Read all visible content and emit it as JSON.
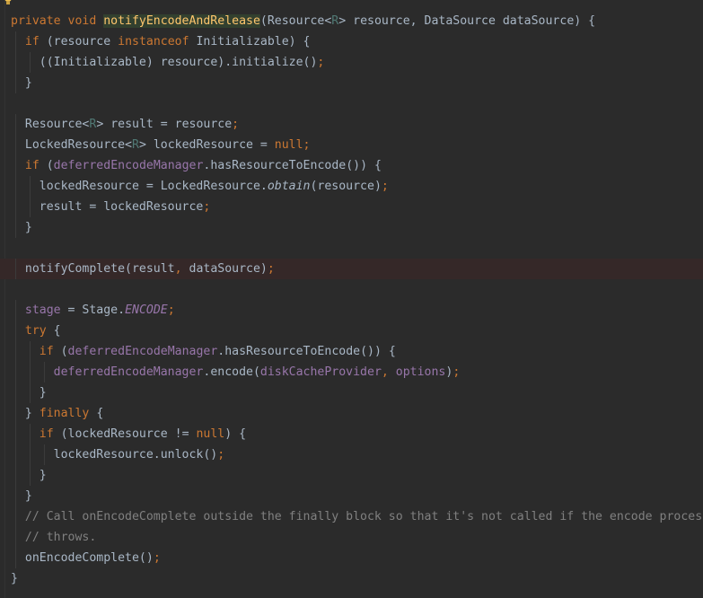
{
  "editor": {
    "highlighted_line": 12,
    "lines": [
      {
        "indent": 0,
        "tokens": [
          [
            "kw",
            "private void "
          ],
          [
            "decl",
            "notifyEncodeAndRelease"
          ],
          [
            "txt",
            "(Resource<"
          ],
          [
            "tp",
            "R"
          ],
          [
            "txt",
            "> resource, DataSource dataSource) {"
          ]
        ]
      },
      {
        "indent": 1,
        "tokens": [
          [
            "kw",
            "if "
          ],
          [
            "txt",
            "(resource "
          ],
          [
            "kw",
            "instanceof "
          ],
          [
            "txt",
            "Initializable) {"
          ]
        ]
      },
      {
        "indent": 2,
        "tokens": [
          [
            "txt",
            "((Initializable) resource).initialize()"
          ],
          [
            "kw",
            ";"
          ]
        ]
      },
      {
        "indent": 1,
        "tokens": [
          [
            "txt",
            "}"
          ]
        ]
      },
      {
        "indent": 0,
        "tokens": []
      },
      {
        "indent": 1,
        "tokens": [
          [
            "txt",
            "Resource<"
          ],
          [
            "tp",
            "R"
          ],
          [
            "txt",
            "> result = resource"
          ],
          [
            "kw",
            ";"
          ]
        ]
      },
      {
        "indent": 1,
        "tokens": [
          [
            "txt",
            "LockedResource<"
          ],
          [
            "tp",
            "R"
          ],
          [
            "txt",
            "> lockedResource = "
          ],
          [
            "kw",
            "null;"
          ]
        ]
      },
      {
        "indent": 1,
        "tokens": [
          [
            "kw",
            "if "
          ],
          [
            "txt",
            "("
          ],
          [
            "fld",
            "deferredEncodeManager"
          ],
          [
            "txt",
            ".hasResourceToEncode()) {"
          ]
        ]
      },
      {
        "indent": 2,
        "tokens": [
          [
            "txt",
            "lockedResource = LockedResource."
          ],
          [
            "ital",
            "obtain"
          ],
          [
            "txt",
            "(resource)"
          ],
          [
            "kw",
            ";"
          ]
        ]
      },
      {
        "indent": 2,
        "tokens": [
          [
            "txt",
            "result = lockedResource"
          ],
          [
            "kw",
            ";"
          ]
        ]
      },
      {
        "indent": 1,
        "tokens": [
          [
            "txt",
            "}"
          ]
        ]
      },
      {
        "indent": 0,
        "tokens": []
      },
      {
        "indent": 1,
        "tokens": [
          [
            "txt",
            "notifyComplete(result"
          ],
          [
            "kw",
            ", "
          ],
          [
            "txt",
            "dataSource)"
          ],
          [
            "kw",
            ";"
          ]
        ]
      },
      {
        "indent": 0,
        "tokens": []
      },
      {
        "indent": 1,
        "tokens": [
          [
            "fld",
            "stage "
          ],
          [
            "txt",
            "= Stage."
          ],
          [
            "sfld",
            "ENCODE"
          ],
          [
            "kw",
            ";"
          ]
        ]
      },
      {
        "indent": 1,
        "tokens": [
          [
            "kw",
            "try "
          ],
          [
            "txt",
            "{"
          ]
        ]
      },
      {
        "indent": 2,
        "tokens": [
          [
            "kw",
            "if "
          ],
          [
            "txt",
            "("
          ],
          [
            "fld",
            "deferredEncodeManager"
          ],
          [
            "txt",
            ".hasResourceToEncode()) {"
          ]
        ]
      },
      {
        "indent": 3,
        "tokens": [
          [
            "fld",
            "deferredEncodeManager"
          ],
          [
            "txt",
            ".encode("
          ],
          [
            "fld",
            "diskCacheProvider"
          ],
          [
            "kw",
            ", "
          ],
          [
            "fld",
            "options"
          ],
          [
            "txt",
            ")"
          ],
          [
            "kw",
            ";"
          ]
        ]
      },
      {
        "indent": 2,
        "tokens": [
          [
            "txt",
            "}"
          ]
        ]
      },
      {
        "indent": 1,
        "tokens": [
          [
            "txt",
            "} "
          ],
          [
            "kw",
            "finally "
          ],
          [
            "txt",
            "{"
          ]
        ]
      },
      {
        "indent": 2,
        "tokens": [
          [
            "kw",
            "if "
          ],
          [
            "txt",
            "(lockedResource != "
          ],
          [
            "kw",
            "null"
          ],
          [
            "txt",
            ") {"
          ]
        ]
      },
      {
        "indent": 3,
        "tokens": [
          [
            "txt",
            "lockedResource.unlock()"
          ],
          [
            "kw",
            ";"
          ]
        ]
      },
      {
        "indent": 2,
        "tokens": [
          [
            "txt",
            "}"
          ]
        ]
      },
      {
        "indent": 1,
        "tokens": [
          [
            "txt",
            "}"
          ]
        ]
      },
      {
        "indent": 1,
        "tokens": [
          [
            "cmt",
            "// Call onEncodeComplete outside the finally block so that it's not called if the encode process"
          ]
        ]
      },
      {
        "indent": 1,
        "tokens": [
          [
            "cmt",
            "// throws."
          ]
        ]
      },
      {
        "indent": 1,
        "tokens": [
          [
            "txt",
            "onEncodeComplete()"
          ],
          [
            "kw",
            ";"
          ]
        ]
      },
      {
        "indent": 0,
        "tokens": [
          [
            "txt",
            "}"
          ]
        ]
      }
    ]
  }
}
